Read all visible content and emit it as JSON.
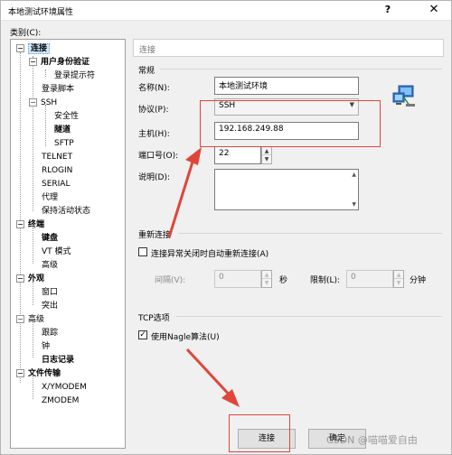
{
  "window": {
    "title": "本地测试环境属性",
    "help": "?",
    "close": "✕"
  },
  "category_label": "类别(C):",
  "tree": [
    {
      "label": "连接",
      "bold": true,
      "selected": true
    },
    {
      "label": "用户身份验证",
      "bold": true
    },
    {
      "label": "登录提示符"
    },
    {
      "label": "登录脚本"
    },
    {
      "label": "SSH"
    },
    {
      "label": "安全性"
    },
    {
      "label": "隧道",
      "bold": true
    },
    {
      "label": "SFTP"
    },
    {
      "label": "TELNET"
    },
    {
      "label": "RLOGIN"
    },
    {
      "label": "SERIAL"
    },
    {
      "label": "代理"
    },
    {
      "label": "保持活动状态"
    },
    {
      "label": "终端",
      "bold": true
    },
    {
      "label": "键盘",
      "bold": true
    },
    {
      "label": "VT 模式"
    },
    {
      "label": "高级"
    },
    {
      "label": "外观",
      "bold": true
    },
    {
      "label": "窗口"
    },
    {
      "label": "突出"
    },
    {
      "label": "高级"
    },
    {
      "label": "跟踪"
    },
    {
      "label": "钟"
    },
    {
      "label": "日志记录",
      "bold": true
    },
    {
      "label": "文件传输",
      "bold": true
    },
    {
      "label": "X/YMODEM"
    },
    {
      "label": "ZMODEM"
    }
  ],
  "header": "连接",
  "general": {
    "title": "常规",
    "name_label": "名称(N):",
    "name_value": "本地测试环境",
    "protocol_label": "协议(P):",
    "protocol_value": "SSH",
    "host_label": "主机(H):",
    "host_value": "192.168.249.88",
    "port_label": "端口号(O):",
    "port_value": "22",
    "desc_label": "说明(D):",
    "icon": "network-computer-icon"
  },
  "reconnect": {
    "title": "重新连接",
    "checkbox_label": "连接异常关闭时自动重新连接(A)",
    "checked": false,
    "interval_label": "间隔(V):",
    "interval_value": "0",
    "interval_unit": "秒",
    "limit_label": "限制(L):",
    "limit_value": "0",
    "limit_unit": "分钟"
  },
  "tcp": {
    "title": "TCP选项",
    "checkbox_label": "使用Nagle算法(U)",
    "checked": true,
    "check_mark": "✓"
  },
  "buttons": {
    "connect": "连接",
    "ok": "确定"
  },
  "watermark": "CSDN @喵喵爱自由",
  "colors": {
    "highlight": "#e0453a",
    "selected": "#cce8ff"
  }
}
